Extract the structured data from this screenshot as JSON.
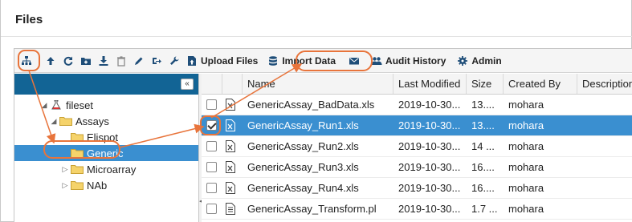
{
  "page": {
    "title": "Files"
  },
  "toolbar": {
    "upload_label": "Upload Files",
    "import_label": "Import Data",
    "audit_label": "Audit History",
    "admin_label": "Admin"
  },
  "tree": {
    "collapse_glyph": "«",
    "items": [
      {
        "label": "fileset",
        "expander": "◢"
      },
      {
        "label": "Assays",
        "expander": "◢"
      },
      {
        "label": "Elispot",
        "expander": ""
      },
      {
        "label": "Generic",
        "expander": "",
        "selected": true
      },
      {
        "label": "Microarray",
        "expander": "▷"
      },
      {
        "label": "NAb",
        "expander": "▷"
      }
    ]
  },
  "grid": {
    "columns": [
      "Name",
      "Last Modified",
      "Size",
      "Created By",
      "Description"
    ],
    "rows": [
      {
        "name": "GenericAssay_BadData.xls",
        "modified": "2019-10-30...",
        "size": "13....",
        "created_by": "mohara",
        "checked": false,
        "selected": false,
        "icon": "excel-file-icon"
      },
      {
        "name": "GenericAssay_Run1.xls",
        "modified": "2019-10-30...",
        "size": "13....",
        "created_by": "mohara",
        "checked": true,
        "selected": true,
        "icon": "excel-file-icon"
      },
      {
        "name": "GenericAssay_Run2.xls",
        "modified": "2019-10-30...",
        "size": "14 ...",
        "created_by": "mohara",
        "checked": false,
        "selected": false,
        "icon": "excel-file-icon"
      },
      {
        "name": "GenericAssay_Run3.xls",
        "modified": "2019-10-30...",
        "size": "16....",
        "created_by": "mohara",
        "checked": false,
        "selected": false,
        "icon": "excel-file-icon"
      },
      {
        "name": "GenericAssay_Run4.xls",
        "modified": "2019-10-30...",
        "size": "16....",
        "created_by": "mohara",
        "checked": false,
        "selected": false,
        "icon": "excel-file-icon"
      },
      {
        "name": "GenericAssay_Transform.pl",
        "modified": "2019-10-30...",
        "size": "1.7 ...",
        "created_by": "mohara",
        "checked": false,
        "selected": false,
        "icon": "text-file-icon"
      }
    ]
  },
  "colors": {
    "accent": "#126495",
    "selection": "#3a8fd0",
    "annotation": "#e8743b"
  }
}
